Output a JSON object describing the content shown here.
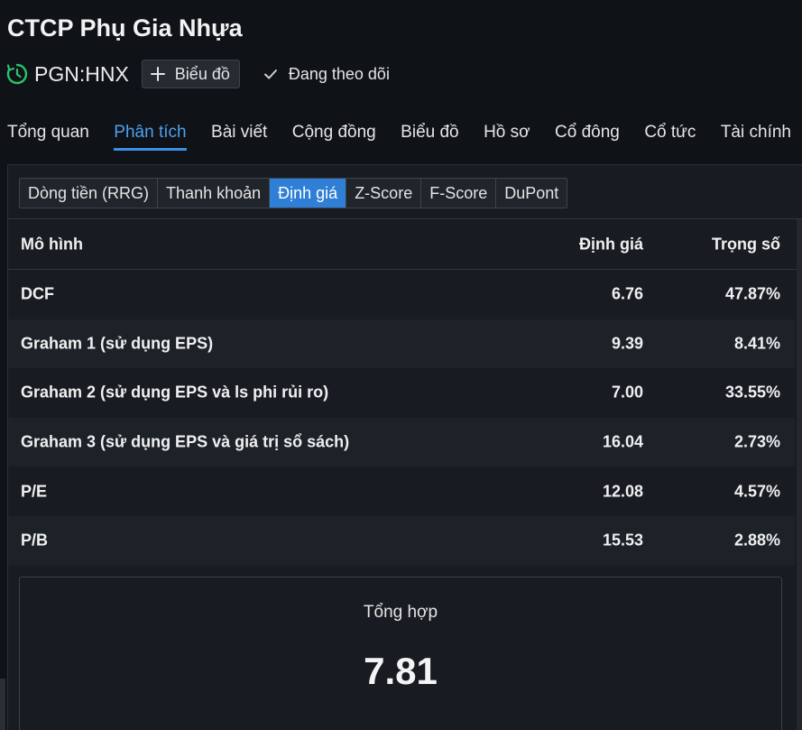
{
  "header": {
    "company_name": "CTCP Phụ Gia Nhựa",
    "ticker": "PGN:HNX",
    "ticker_icon": "clock-refresh-icon",
    "chart_button": "Biểu đồ",
    "follow_label": "Đang theo dõi"
  },
  "nav": {
    "tabs": [
      {
        "label": "Tổng quan"
      },
      {
        "label": "Phân tích",
        "active": true
      },
      {
        "label": "Bài viết"
      },
      {
        "label": "Cộng đồng"
      },
      {
        "label": "Biểu đồ"
      },
      {
        "label": "Hồ sơ"
      },
      {
        "label": "Cổ đông"
      },
      {
        "label": "Cổ tức"
      },
      {
        "label": "Tài chính"
      }
    ]
  },
  "subtabs": {
    "items": [
      {
        "label": "Dòng tiền (RRG)"
      },
      {
        "label": "Thanh khoản"
      },
      {
        "label": "Định giá",
        "active": true
      },
      {
        "label": "Z-Score"
      },
      {
        "label": "F-Score"
      },
      {
        "label": "DuPont"
      }
    ]
  },
  "table": {
    "headers": {
      "model": "Mô hình",
      "value": "Định giá",
      "weight": "Trọng số"
    },
    "rows": [
      {
        "model": "DCF",
        "value": "6.76",
        "weight": "47.87%"
      },
      {
        "model": "Graham 1 (sử dụng EPS)",
        "value": "9.39",
        "weight": "8.41%"
      },
      {
        "model": "Graham 2 (sử dụng EPS và ls phi rủi ro)",
        "value": "7.00",
        "weight": "33.55%"
      },
      {
        "model": "Graham 3 (sử dụng EPS và giá trị sổ sách)",
        "value": "16.04",
        "weight": "2.73%"
      },
      {
        "model": "P/E",
        "value": "12.08",
        "weight": "4.57%"
      },
      {
        "model": "P/B",
        "value": "15.53",
        "weight": "2.88%"
      }
    ]
  },
  "summary": {
    "label": "Tổng hợp",
    "value": "7.81"
  },
  "colors": {
    "background": "#0f1217",
    "panel": "#181c22",
    "accent": "#3d8fe6",
    "active_subtab": "#2f7fd6",
    "ticker_icon": "#2bc26a"
  }
}
